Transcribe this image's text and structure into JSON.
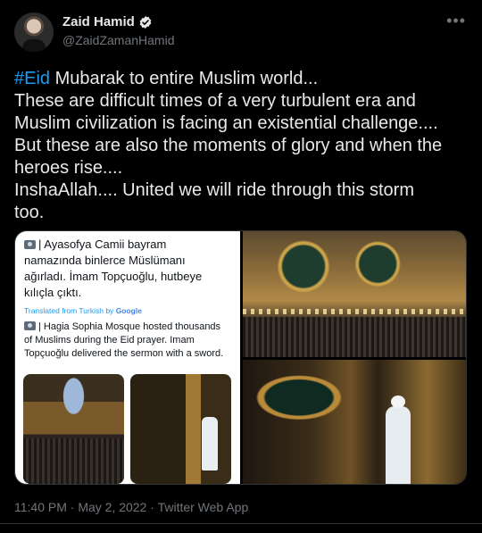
{
  "author": {
    "display_name": "Zaid Hamid",
    "handle": "@ZaidZamanHamid",
    "verified": true,
    "avatar_icon": "user-avatar"
  },
  "more_icon": "more-options-icon",
  "tweet": {
    "hashtag": "#Eid",
    "line1_rest": " Mubarak to entire Muslim world...",
    "lines": [
      "These are difficult times of a very turbulent era and",
      "Muslim civilization is facing an existential challenge....",
      "But these are also the moments of glory and when the",
      "heroes rise....",
      "InshaAllah.... United we will ride through this storm",
      "too."
    ]
  },
  "media": {
    "screenshot": {
      "turkish_lines": [
        "| Ayasofya Camii bayram",
        "namazında binlerce Müslümanı",
        "ağırladı. İmam Topçuoğlu, hutbeye",
        "kılıçla çıktı."
      ],
      "translated_label": "Translated from Turkish by",
      "translated_brand": "Google",
      "english_lines": [
        "| Hagia Sophia Mosque hosted thousands",
        "of Muslims during the Eid prayer. Imam",
        "Topçuoğlu delivered the sermon with a sword."
      ]
    }
  },
  "timestamp": "11:40 PM · May 2, 2022 · Twitter Web App",
  "colors": {
    "background": "#000000",
    "text": "#e7e9ea",
    "muted": "#71767b",
    "accent": "#1d9bf0"
  }
}
